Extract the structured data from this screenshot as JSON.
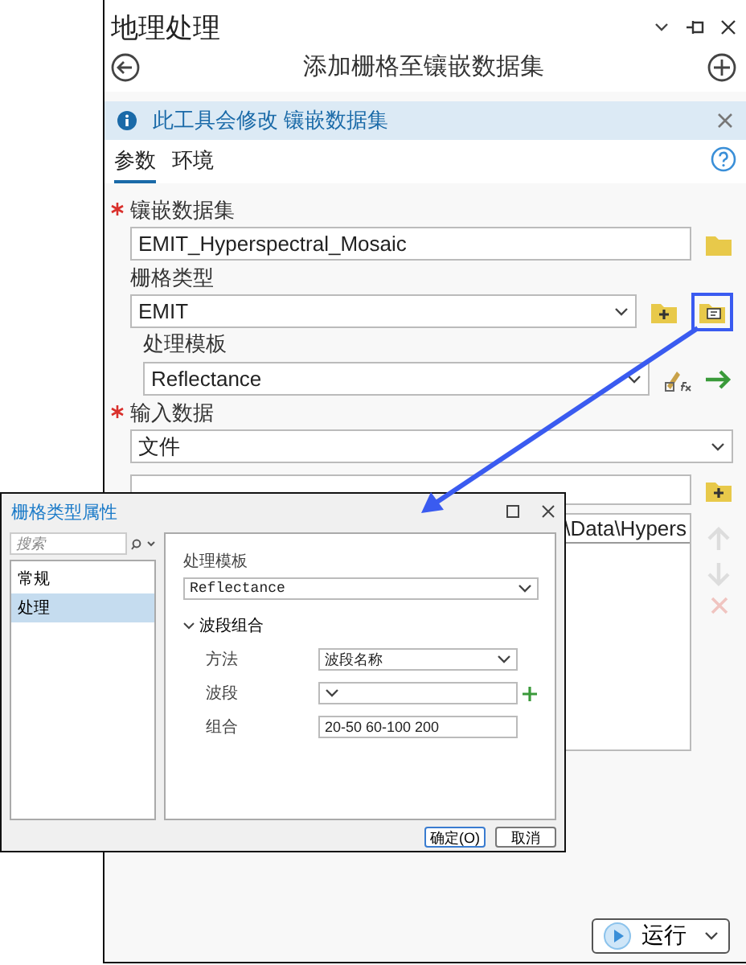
{
  "panel": {
    "title": "地理处理",
    "tool_title": "添加栅格至镶嵌数据集"
  },
  "info_bar": {
    "text": "此工具会修改 镶嵌数据集"
  },
  "tabs": [
    {
      "label": "参数",
      "selected": true
    },
    {
      "label": "环境",
      "selected": false
    }
  ],
  "mosaic_dataset": {
    "label": "镶嵌数据集",
    "required": true,
    "value": "EMIT_Hyperspectral_Mosaic"
  },
  "raster_type": {
    "label": "栅格类型",
    "required": false,
    "value": "EMIT"
  },
  "processing_template": {
    "label": "处理模板",
    "value": "Reflectance"
  },
  "input_data": {
    "label": "输入数据",
    "required": true,
    "type_value": "文件",
    "list_items": [
      "\\Data\\Hypers"
    ]
  },
  "run_button": {
    "label": "运行"
  },
  "dialog": {
    "title": "栅格类型属性",
    "search_placeholder": "搜索",
    "nav_items": [
      {
        "label": "常规",
        "selected": false
      },
      {
        "label": "处理",
        "selected": true
      }
    ],
    "template_label": "处理模板",
    "template_value": "Reflectance",
    "section": {
      "label": "波段组合",
      "expanded": true
    },
    "rows": [
      {
        "kind": "select",
        "label": "方法",
        "value": "波段名称"
      },
      {
        "kind": "select-add",
        "label": "波段"
      },
      {
        "kind": "text",
        "label": "组合",
        "value": "20-50 60-100 200"
      }
    ],
    "buttons": [
      {
        "label": "确定(O)",
        "kind": "primary"
      },
      {
        "label": "取消",
        "kind": "secondary"
      }
    ]
  }
}
